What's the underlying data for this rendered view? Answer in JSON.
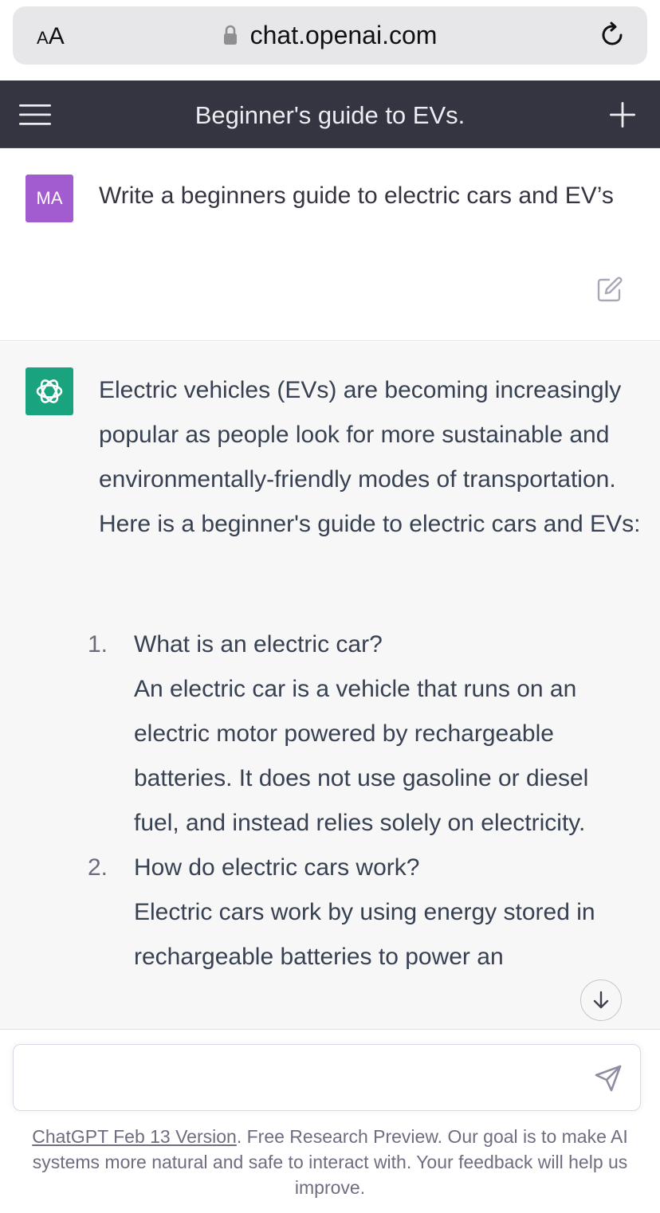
{
  "browser": {
    "text_size_label": "AA",
    "url": "chat.openai.com"
  },
  "header": {
    "title": "Beginner's guide to EVs."
  },
  "user_message": {
    "avatar_initials": "MA",
    "text": "Write a beginners guide to electric cars and EV’s"
  },
  "assistant_message": {
    "intro": "Electric vehicles (EVs) are becoming increasingly popular as people look for more sustainable and environmentally-friendly modes of transportation. Here is a beginner's guide to electric cars and EVs:",
    "items": [
      {
        "number": "1.",
        "question": "What is an electric car?",
        "answer": "An electric car is a vehicle that runs on an electric motor powered by rechargeable batteries. It does not use gasoline or diesel fuel, and instead relies solely on electricity."
      },
      {
        "number": "2.",
        "question": "How do electric cars work?",
        "answer": "Electric cars work by using energy stored in rechargeable batteries to power an"
      }
    ]
  },
  "composer": {
    "value": "",
    "placeholder": ""
  },
  "footer": {
    "version_link": "ChatGPT Feb 13 Version",
    "note": ". Free Research Preview. Our goal is to make AI systems more natural and safe to interact with. Your feedback will help us improve."
  },
  "colors": {
    "header_bg": "#343541",
    "user_avatar": "#a35bd0",
    "gpt_avatar": "#19a37f",
    "assistant_bg": "#f7f7f8"
  }
}
